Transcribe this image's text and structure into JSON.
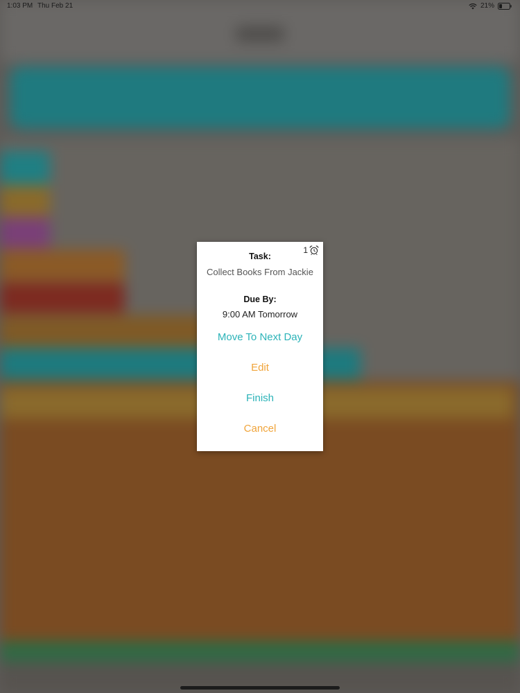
{
  "status_bar": {
    "time": "1:03 PM",
    "date": "Thu Feb 21",
    "battery": "21%"
  },
  "dialog": {
    "alarm_count": "1",
    "alarm_icon": "alarm-clock-icon",
    "task_label": "Task:",
    "task_value": "Collect Books From Jackie",
    "due_label": "Due By:",
    "due_value": "9:00 AM Tomorrow",
    "actions": {
      "move": "Move To Next Day",
      "edit": "Edit",
      "finish": "Finish",
      "cancel": "Cancel"
    }
  },
  "colors": {
    "teal": "#2bb3b8",
    "orange": "#f0a43a"
  }
}
